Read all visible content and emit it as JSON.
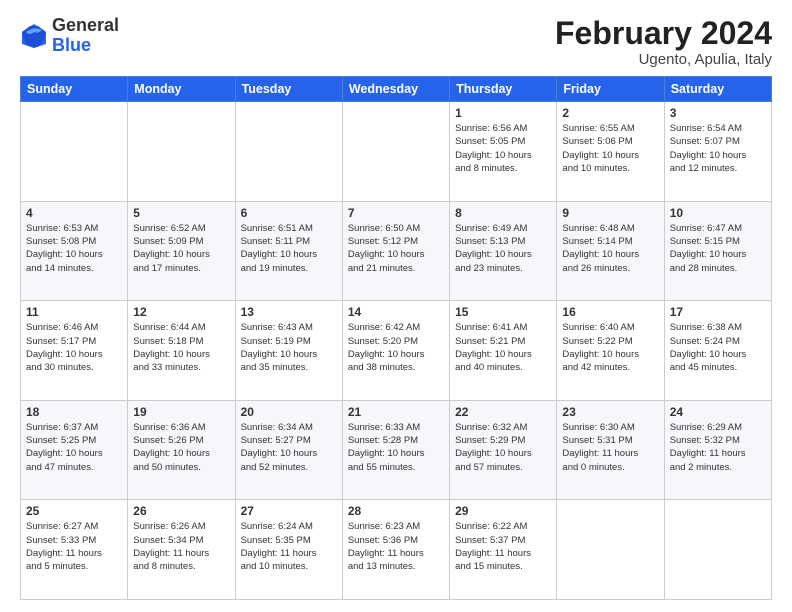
{
  "header": {
    "logo_general": "General",
    "logo_blue": "Blue",
    "main_title": "February 2024",
    "subtitle": "Ugento, Apulia, Italy"
  },
  "calendar": {
    "days_of_week": [
      "Sunday",
      "Monday",
      "Tuesday",
      "Wednesday",
      "Thursday",
      "Friday",
      "Saturday"
    ],
    "weeks": [
      [
        {
          "day": "",
          "content": ""
        },
        {
          "day": "",
          "content": ""
        },
        {
          "day": "",
          "content": ""
        },
        {
          "day": "",
          "content": ""
        },
        {
          "day": "1",
          "content": "Sunrise: 6:56 AM\nSunset: 5:05 PM\nDaylight: 10 hours\nand 8 minutes."
        },
        {
          "day": "2",
          "content": "Sunrise: 6:55 AM\nSunset: 5:06 PM\nDaylight: 10 hours\nand 10 minutes."
        },
        {
          "day": "3",
          "content": "Sunrise: 6:54 AM\nSunset: 5:07 PM\nDaylight: 10 hours\nand 12 minutes."
        }
      ],
      [
        {
          "day": "4",
          "content": "Sunrise: 6:53 AM\nSunset: 5:08 PM\nDaylight: 10 hours\nand 14 minutes."
        },
        {
          "day": "5",
          "content": "Sunrise: 6:52 AM\nSunset: 5:09 PM\nDaylight: 10 hours\nand 17 minutes."
        },
        {
          "day": "6",
          "content": "Sunrise: 6:51 AM\nSunset: 5:11 PM\nDaylight: 10 hours\nand 19 minutes."
        },
        {
          "day": "7",
          "content": "Sunrise: 6:50 AM\nSunset: 5:12 PM\nDaylight: 10 hours\nand 21 minutes."
        },
        {
          "day": "8",
          "content": "Sunrise: 6:49 AM\nSunset: 5:13 PM\nDaylight: 10 hours\nand 23 minutes."
        },
        {
          "day": "9",
          "content": "Sunrise: 6:48 AM\nSunset: 5:14 PM\nDaylight: 10 hours\nand 26 minutes."
        },
        {
          "day": "10",
          "content": "Sunrise: 6:47 AM\nSunset: 5:15 PM\nDaylight: 10 hours\nand 28 minutes."
        }
      ],
      [
        {
          "day": "11",
          "content": "Sunrise: 6:46 AM\nSunset: 5:17 PM\nDaylight: 10 hours\nand 30 minutes."
        },
        {
          "day": "12",
          "content": "Sunrise: 6:44 AM\nSunset: 5:18 PM\nDaylight: 10 hours\nand 33 minutes."
        },
        {
          "day": "13",
          "content": "Sunrise: 6:43 AM\nSunset: 5:19 PM\nDaylight: 10 hours\nand 35 minutes."
        },
        {
          "day": "14",
          "content": "Sunrise: 6:42 AM\nSunset: 5:20 PM\nDaylight: 10 hours\nand 38 minutes."
        },
        {
          "day": "15",
          "content": "Sunrise: 6:41 AM\nSunset: 5:21 PM\nDaylight: 10 hours\nand 40 minutes."
        },
        {
          "day": "16",
          "content": "Sunrise: 6:40 AM\nSunset: 5:22 PM\nDaylight: 10 hours\nand 42 minutes."
        },
        {
          "day": "17",
          "content": "Sunrise: 6:38 AM\nSunset: 5:24 PM\nDaylight: 10 hours\nand 45 minutes."
        }
      ],
      [
        {
          "day": "18",
          "content": "Sunrise: 6:37 AM\nSunset: 5:25 PM\nDaylight: 10 hours\nand 47 minutes."
        },
        {
          "day": "19",
          "content": "Sunrise: 6:36 AM\nSunset: 5:26 PM\nDaylight: 10 hours\nand 50 minutes."
        },
        {
          "day": "20",
          "content": "Sunrise: 6:34 AM\nSunset: 5:27 PM\nDaylight: 10 hours\nand 52 minutes."
        },
        {
          "day": "21",
          "content": "Sunrise: 6:33 AM\nSunset: 5:28 PM\nDaylight: 10 hours\nand 55 minutes."
        },
        {
          "day": "22",
          "content": "Sunrise: 6:32 AM\nSunset: 5:29 PM\nDaylight: 10 hours\nand 57 minutes."
        },
        {
          "day": "23",
          "content": "Sunrise: 6:30 AM\nSunset: 5:31 PM\nDaylight: 11 hours\nand 0 minutes."
        },
        {
          "day": "24",
          "content": "Sunrise: 6:29 AM\nSunset: 5:32 PM\nDaylight: 11 hours\nand 2 minutes."
        }
      ],
      [
        {
          "day": "25",
          "content": "Sunrise: 6:27 AM\nSunset: 5:33 PM\nDaylight: 11 hours\nand 5 minutes."
        },
        {
          "day": "26",
          "content": "Sunrise: 6:26 AM\nSunset: 5:34 PM\nDaylight: 11 hours\nand 8 minutes."
        },
        {
          "day": "27",
          "content": "Sunrise: 6:24 AM\nSunset: 5:35 PM\nDaylight: 11 hours\nand 10 minutes."
        },
        {
          "day": "28",
          "content": "Sunrise: 6:23 AM\nSunset: 5:36 PM\nDaylight: 11 hours\nand 13 minutes."
        },
        {
          "day": "29",
          "content": "Sunrise: 6:22 AM\nSunset: 5:37 PM\nDaylight: 11 hours\nand 15 minutes."
        },
        {
          "day": "",
          "content": ""
        },
        {
          "day": "",
          "content": ""
        }
      ]
    ]
  }
}
